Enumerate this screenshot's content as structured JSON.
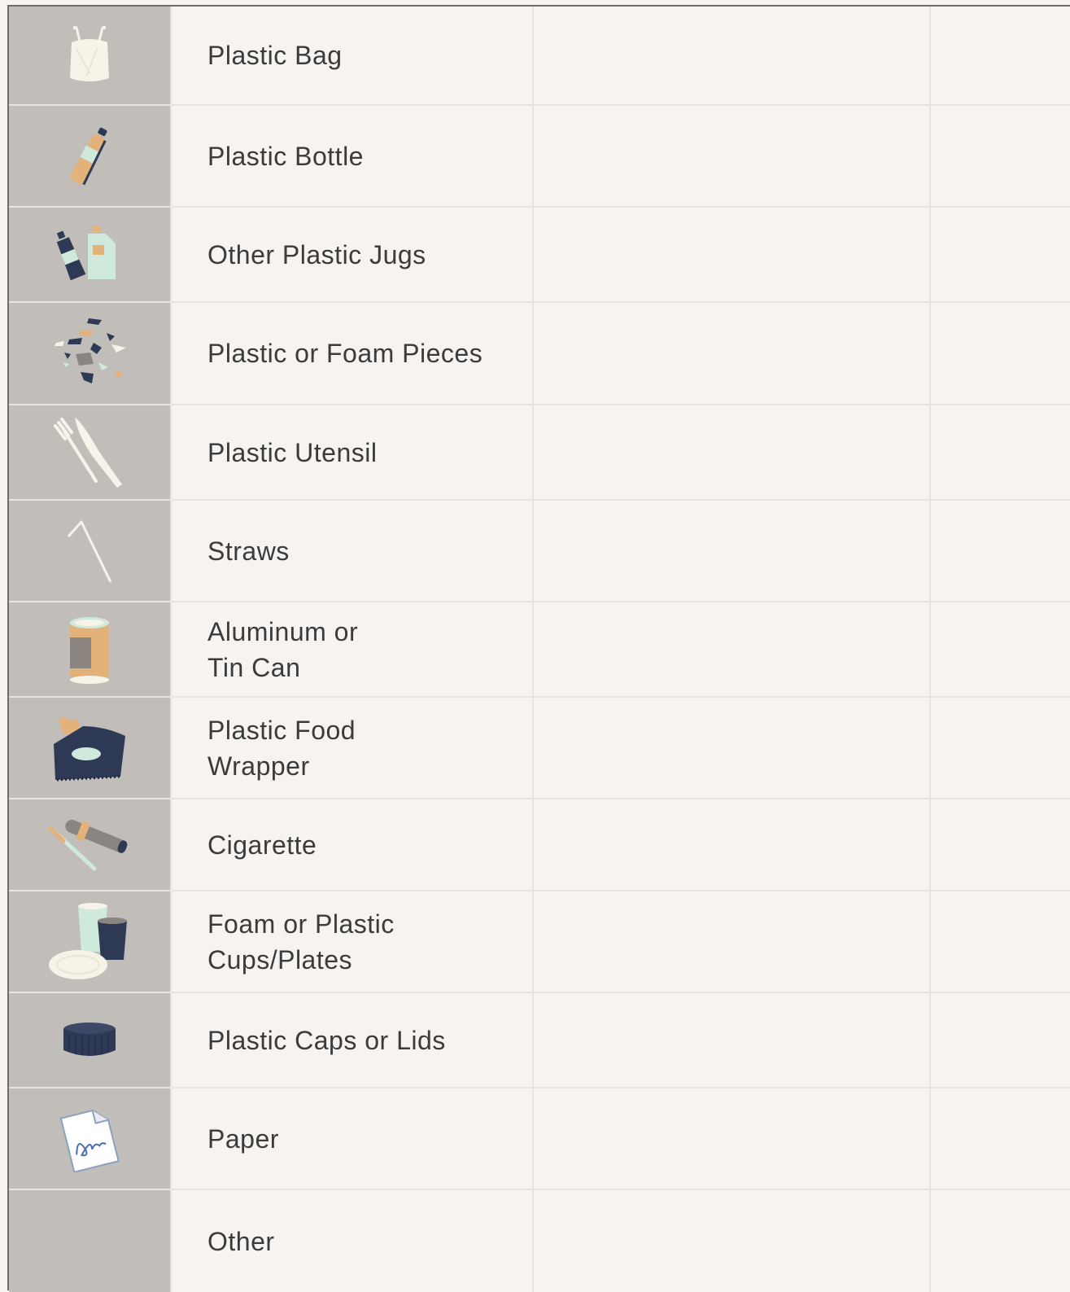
{
  "items": [
    {
      "label": "Plastic Bag",
      "icon": "plastic-bag-icon"
    },
    {
      "label": "Plastic Bottle",
      "icon": "plastic-bottle-icon"
    },
    {
      "label": "Other Plastic Jugs",
      "icon": "plastic-jugs-icon"
    },
    {
      "label": "Plastic or Foam Pieces",
      "icon": "foam-pieces-icon"
    },
    {
      "label": "Plastic Utensil",
      "icon": "utensil-icon"
    },
    {
      "label": "Straws",
      "icon": "straw-icon"
    },
    {
      "label": "Aluminum or\nTin Can",
      "icon": "can-icon"
    },
    {
      "label": "Plastic Food\nWrapper",
      "icon": "food-wrapper-icon"
    },
    {
      "label": "Cigarette",
      "icon": "cigarette-icon"
    },
    {
      "label": "Foam or Plastic\nCups/Plates",
      "icon": "cups-plates-icon"
    },
    {
      "label": "Plastic Caps or Lids",
      "icon": "cap-icon"
    },
    {
      "label": "Paper",
      "icon": "paper-icon"
    },
    {
      "label": "Other",
      "icon": ""
    }
  ],
  "colors": {
    "icon_column": "#c1beba",
    "sheet": "#f6f3f0",
    "grid": "#e6e3e0",
    "navy": "#2e3a55",
    "tan": "#e3b27a",
    "mint": "#cfe9dc",
    "cream": "#f6f4e8"
  }
}
